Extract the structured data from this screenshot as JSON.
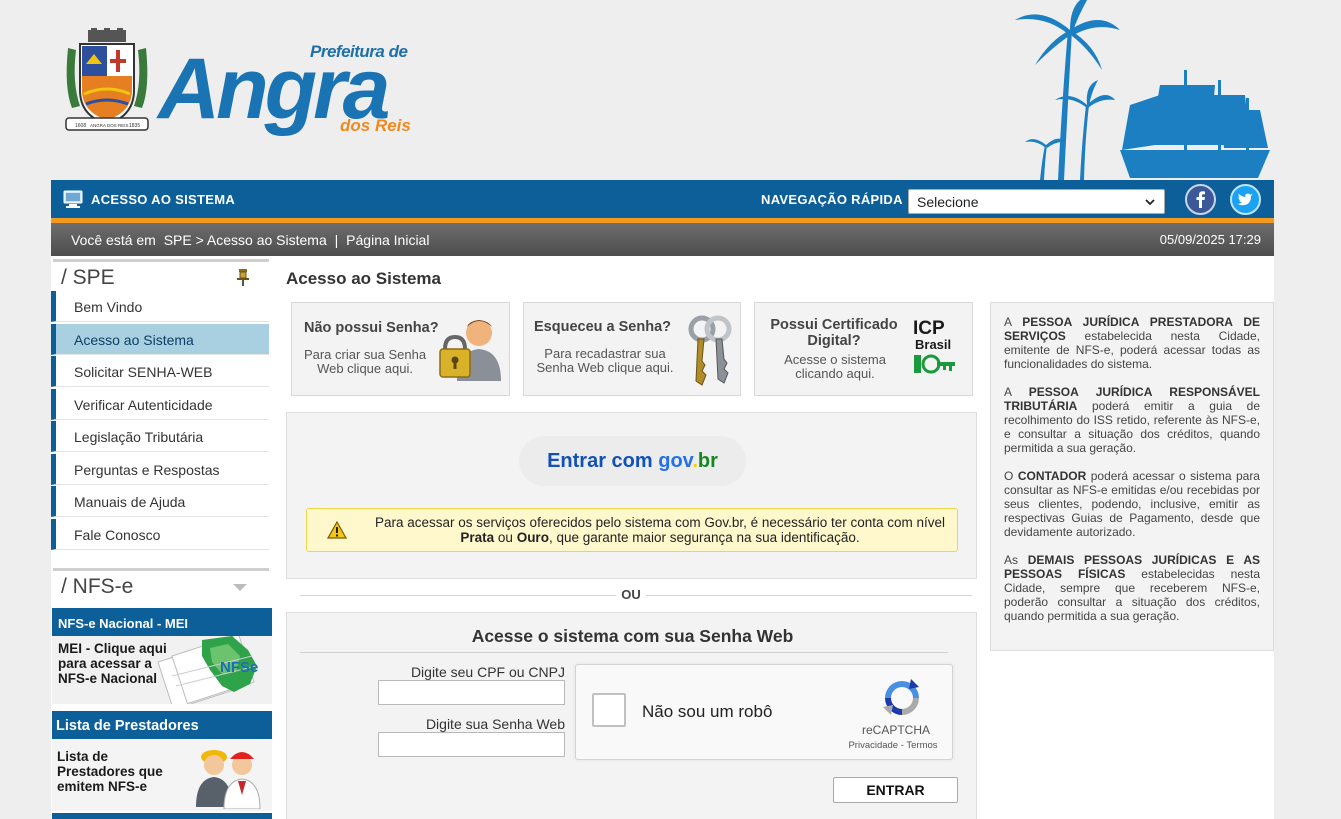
{
  "header": {
    "brand_top": "Prefeitura de",
    "brand_main": "Angra",
    "brand_sub": "dos Reis",
    "crest_year": "1608",
    "crest_city": "ANGRA DOS REIS",
    "crest_date": "1835"
  },
  "topbar": {
    "title": "ACESSO AO SISTEMA",
    "nav_label": "NAVEGAÇÃO RÁPIDA",
    "nav_select_value": "Selecione",
    "colors": {
      "primary": "#0d5f99",
      "accent": "#f39a1e"
    }
  },
  "breadcrumb": {
    "prefix": "Você está em",
    "path": "SPE > Acesso ao Sistema",
    "separator": "|",
    "current": "Página Inicial",
    "datetime": "05/09/2025 17:29"
  },
  "sidebar": {
    "spe_heading": "/ SPE",
    "items": [
      {
        "label": "Bem Vindo",
        "active": false
      },
      {
        "label": "Acesso ao Sistema",
        "active": true
      },
      {
        "label": "Solicitar SENHA-WEB",
        "active": false
      },
      {
        "label": "Verificar Autenticidade",
        "active": false
      },
      {
        "label": "Legislação Tributária",
        "active": false
      },
      {
        "label": "Perguntas e Respostas",
        "active": false
      },
      {
        "label": "Manuais de Ajuda",
        "active": false
      },
      {
        "label": "Fale Conosco",
        "active": false
      }
    ],
    "nfse_heading": "/ NFS-e",
    "banner_mei": {
      "title": "NFS-e Nacional - MEI",
      "text": "MEI - Clique aqui para acessar a NFS-e Nacional",
      "logo": "NFSe"
    },
    "banner_prestadores": {
      "title": "Lista de Prestadores",
      "text": "Lista de Prestadores que emitem NFS-e"
    }
  },
  "main": {
    "title": "Acesso ao Sistema",
    "cards": [
      {
        "title": "Não possui Senha?",
        "subtitle": "Para criar sua Senha Web clique aqui.",
        "icon": "user-lock-icon"
      },
      {
        "title": "Esqueceu a Senha?",
        "subtitle": "Para recadastrar sua Senha Web clique aqui.",
        "icon": "keys-icon"
      },
      {
        "title": "Possui Certificado Digital?",
        "subtitle": "Acesse o sistema clicando aqui.",
        "icon": "icp-brasil-logo",
        "logo_line1": "ICP",
        "logo_line2": "Brasil"
      }
    ],
    "gov": {
      "button_prefix": "Entrar com",
      "button_brand_1": "gov",
      "button_brand_2": ".",
      "button_brand_3": "br",
      "warning_1": "Para acessar os serviços oferecidos pelo sistema com Gov.br, é necessário ter conta com nível",
      "warning_bold_1": "Prata",
      "warning_mid": "ou",
      "warning_bold_2": "Ouro",
      "warning_2": ", que garante maior segurança na sua identificação."
    },
    "divider": "OU",
    "login": {
      "title": "Acesse o sistema com sua Senha Web",
      "cpf_label": "Digite seu CPF ou CNPJ",
      "cpf_value": "",
      "password_label": "Digite sua Senha Web",
      "password_value": "",
      "captcha_label": "Não sou um robô",
      "captcha_brand": "reCAPTCHA",
      "captcha_privacy": "Privacidade",
      "captcha_sep": "-",
      "captcha_terms": "Termos",
      "submit": "ENTRAR"
    }
  },
  "info": {
    "p1_a": "A",
    "p1_b": "PESSOA JURÍDICA PRESTADORA DE SERVIÇOS",
    "p1_c": "estabelecida nesta Cidade, emitente de NFS-e, poderá acessar todas as funcionalidades do sistema.",
    "p2_a": "A",
    "p2_b": "PESSOA JURÍDICA RESPONSÁVEL TRIBUTÁRIA",
    "p2_c": "poderá emitir a guia de recolhimento do ISS retido, referente às NFS-e, e consultar a situação dos créditos, quando permitida a sua geração.",
    "p3_a": "O",
    "p3_b": "CONTADOR",
    "p3_c": "poderá acessar o sistema para consultar as NFS-e emitidas e/ou recebidas por seus clientes, podendo, inclusive, emitir as respectivas Guias de Pagamento, desde que devidamente autorizado.",
    "p4_a": "As",
    "p4_b": "DEMAIS PESSOAS JURÍDICAS E AS PESSOAS FÍSICAS",
    "p4_c": "estabelecidas nesta Cidade, sempre que receberem NFS-e, poderão consultar a situação dos créditos, quando permitida a sua geração."
  }
}
